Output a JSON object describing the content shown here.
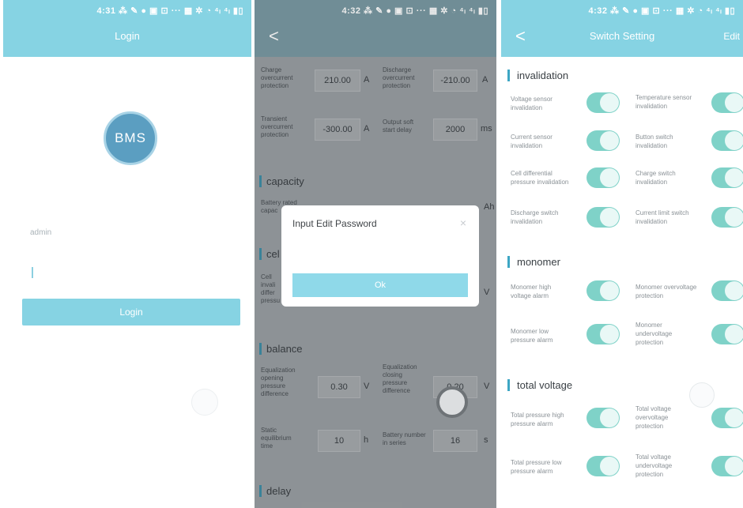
{
  "status_left": "4:31 ⁂ ✎ ● ▣ ⊡ ···  ▦ ✲ ◔ ⁴ₗ ⁴ₗ ▮▯",
  "status_mid": "4:32 ⁂ ✎ ● ▣ ⊡ ···  ▦ ✲ ◔ ⁴ₗ ⁴ₗ ▮▯",
  "status_right": "4:32 ⁂ ✎ ● ▣ ⊡ ···  ▦ ✲ ◔ ⁴ₗ ⁴ₗ ▮▯",
  "login": {
    "title": "Login",
    "logo_text": "BMS",
    "username": "admin",
    "button": "Login"
  },
  "edit": {
    "back": "<",
    "sections": {
      "capacity": "capacity",
      "cell": "cel",
      "balance": "balance",
      "delay": "delay"
    },
    "charge_overcurrent": {
      "label": [
        "Charge",
        "overcurrent",
        "protection"
      ],
      "value": "210.00",
      "unit": "A"
    },
    "discharge_overcurrent": {
      "label": [
        "Discharge",
        "overcurrent",
        "protection"
      ],
      "value": "-210.00",
      "unit": "A"
    },
    "transient_overcurrent": {
      "label": [
        "Transient",
        "overcurrent",
        "protection"
      ],
      "value": "-300.00",
      "unit": "A"
    },
    "output_soft_start": {
      "label": [
        "Output soft",
        "start delay"
      ],
      "value": "2000",
      "unit": "ms"
    },
    "battery_rated": {
      "label": [
        "Battery rated",
        "capac"
      ],
      "unit": "Ah"
    },
    "cell_label": [
      "Cell",
      "invali",
      "differ",
      "pressu"
    ],
    "cell_unit": "V",
    "eq_opening": {
      "label": [
        "Equalization",
        "opening",
        "pressure",
        "difference"
      ],
      "value": "0.30",
      "unit": "V"
    },
    "eq_closing": {
      "label": [
        "Equalization",
        "closing",
        "pressure",
        "difference"
      ],
      "value": "0.20",
      "unit": "V"
    },
    "static_eq": {
      "label": [
        "Static",
        "equilibrium",
        "time"
      ],
      "value": "10",
      "unit": "h"
    },
    "battery_series": {
      "label": [
        "Battery number",
        "in series"
      ],
      "value": "16",
      "unit": "s"
    },
    "modal": {
      "title": "Input Edit Password",
      "close": "×",
      "ok": "Ok"
    }
  },
  "switch": {
    "back": "<",
    "title": "Switch Setting",
    "right": "Edit",
    "sections": {
      "invalidation": "invalidation",
      "monomer": "monomer",
      "total_voltage": "total voltage"
    },
    "items": {
      "voltage_sensor": [
        "Voltage sensor",
        "invalidation"
      ],
      "temperature_sensor": [
        "Temperature sensor",
        "invalidation"
      ],
      "current_sensor": [
        "Current sensor",
        "invalidation"
      ],
      "button_switch": [
        "Button switch",
        "invalidation"
      ],
      "cell_diff": [
        "Cell differential",
        "pressure invalidation"
      ],
      "charge_switch": [
        "Charge switch",
        "invalidation"
      ],
      "discharge_switch": [
        "Discharge switch",
        "invalidation"
      ],
      "current_limit": [
        "Current limit switch",
        "invalidation"
      ],
      "mono_high_alarm": [
        "Monomer high",
        "voltage alarm"
      ],
      "mono_overvoltage": [
        "Monomer overvoltage",
        "protection"
      ],
      "mono_low_alarm": [
        "Monomer low",
        "pressure alarm"
      ],
      "mono_undervoltage": [
        "Monomer",
        "undervoltage",
        "protection"
      ],
      "total_high_alarm": [
        "Total pressure high",
        "pressure alarm"
      ],
      "total_overvoltage": [
        "Total voltage",
        "overvoltage",
        "protection"
      ],
      "total_low_alarm": [
        "Total pressure low",
        "pressure alarm"
      ],
      "total_undervoltage": [
        "Total voltage",
        "undervoltage",
        "protection"
      ]
    }
  }
}
